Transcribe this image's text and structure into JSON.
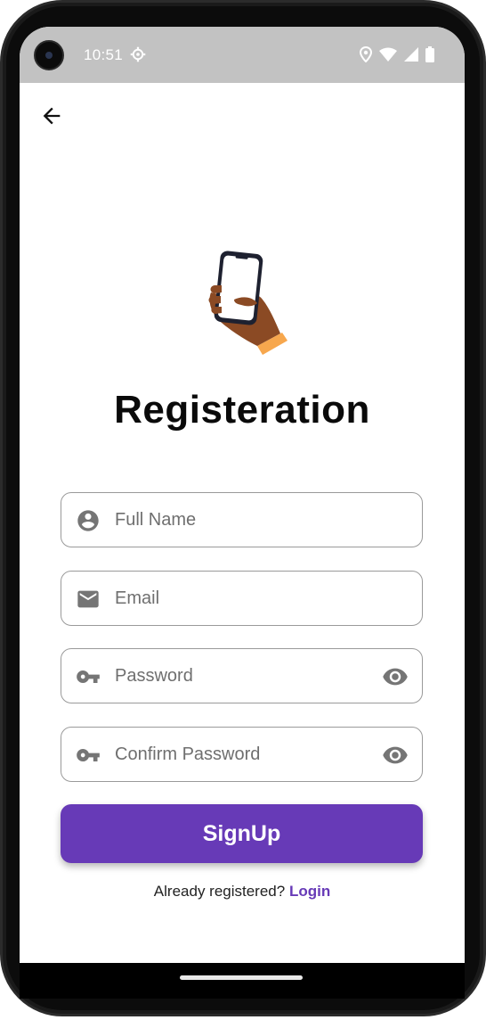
{
  "status_bar": {
    "time": "10:51",
    "icons": [
      "settings-gear-icon",
      "location-icon",
      "wifi-icon",
      "signal-icon",
      "battery-icon"
    ],
    "background": "#c2c2c2"
  },
  "header": {
    "back_icon": "arrow-back-icon"
  },
  "hero": {
    "illustration": "hand-holding-phone-icon",
    "title": "Registeration"
  },
  "form": {
    "full_name": {
      "placeholder": "Full Name",
      "value": "",
      "icon": "account-circle-icon"
    },
    "email": {
      "placeholder": "Email",
      "value": "",
      "icon": "mail-icon"
    },
    "password": {
      "placeholder": "Password",
      "value": "",
      "icon": "key-icon",
      "toggle_icon": "eye-icon"
    },
    "confirm_password": {
      "placeholder": "Confirm Password",
      "value": "",
      "icon": "key-icon",
      "toggle_icon": "eye-icon"
    }
  },
  "signup_button": {
    "label": "SignUp"
  },
  "footer": {
    "prompt": "Already registered? ",
    "login_label": "Login"
  },
  "colors": {
    "accent": "#673ab7",
    "icon_grey": "#757575",
    "field_border": "#9a9a9a"
  }
}
